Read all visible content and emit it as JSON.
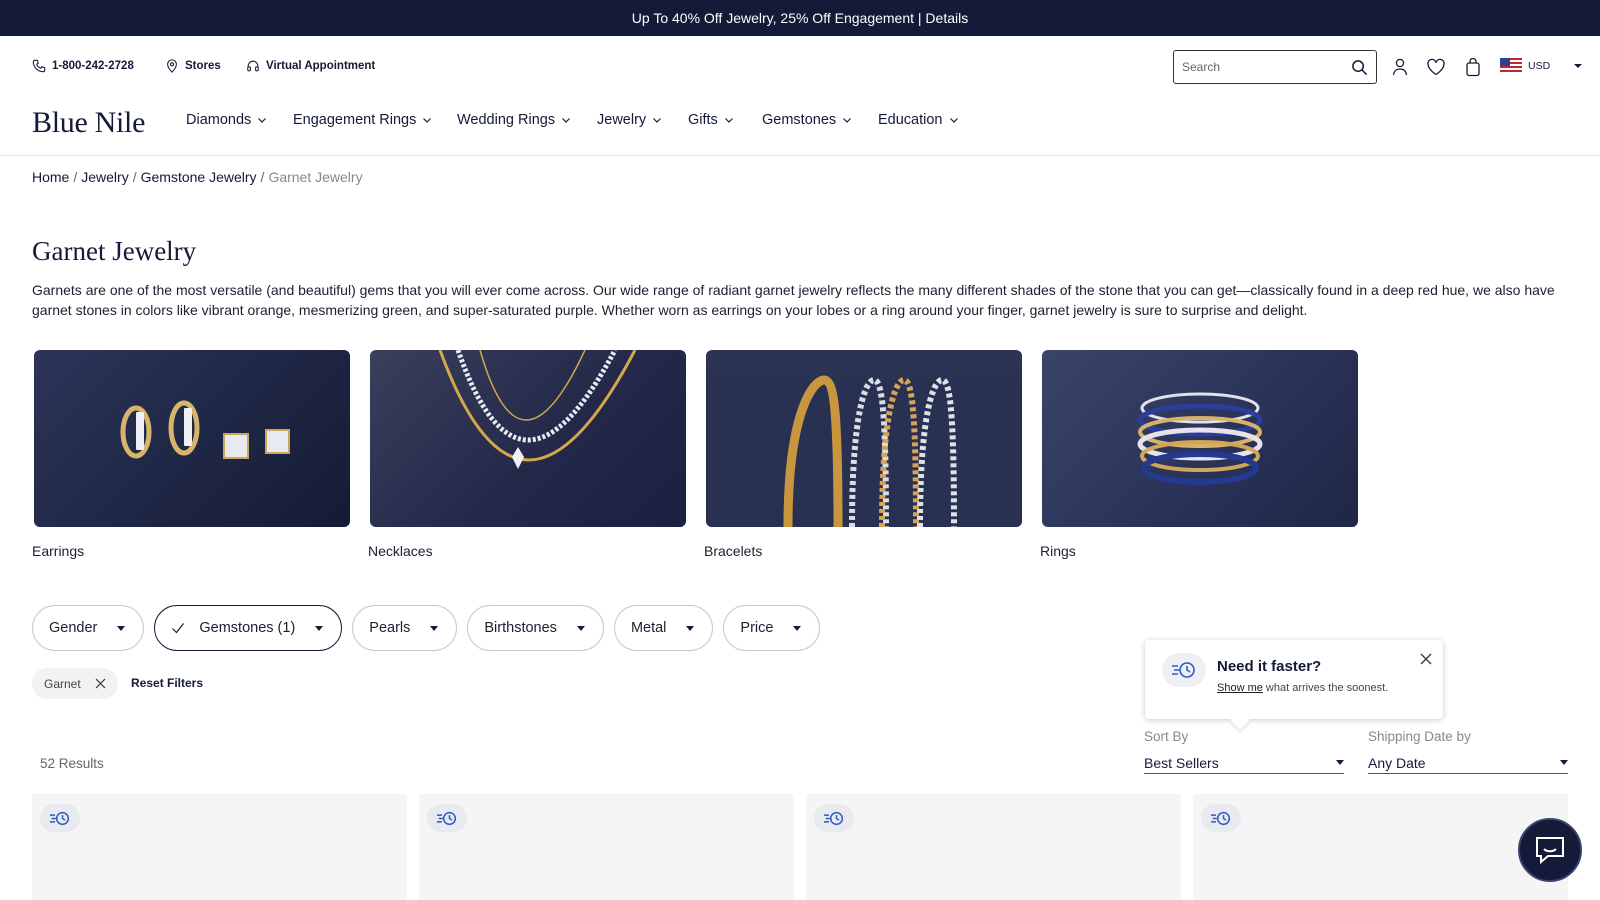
{
  "promo": {
    "text": "Up To 40% Off Jewelry, 25% Off Engagement | Details"
  },
  "utility": {
    "phone": "1-800-242-2728",
    "stores": "Stores",
    "appointment": "Virtual Appointment",
    "search_placeholder": "Search",
    "currency": "USD"
  },
  "brand": {
    "logo": "Blue Nile"
  },
  "nav": {
    "items": [
      "Diamonds",
      "Engagement Rings",
      "Wedding Rings",
      "Jewelry",
      "Gifts",
      "Gemstones",
      "Education"
    ]
  },
  "breadcrumb": {
    "items": [
      "Home",
      "Jewelry",
      "Gemstone Jewelry"
    ],
    "current": "Garnet Jewelry"
  },
  "page": {
    "title": "Garnet Jewelry",
    "description": "Garnets are one of the most versatile (and beautiful) gems that you will ever come across. Our wide range of radiant garnet jewelry reflects the many different shades of the stone that you can get—classically found in a deep red hue, we also have garnet stones in colors like vibrant orange, mesmerizing green, and super-saturated purple. Whether worn as earrings on your lobes or a ring around your finger, garnet jewelry is sure to surprise and delight."
  },
  "categories": [
    {
      "label": "Earrings"
    },
    {
      "label": "Necklaces"
    },
    {
      "label": "Bracelets"
    },
    {
      "label": "Rings"
    }
  ],
  "filters": [
    {
      "label": "Gender",
      "active": false
    },
    {
      "label": "Gemstones (1)",
      "active": true
    },
    {
      "label": "Pearls",
      "active": false
    },
    {
      "label": "Birthstones",
      "active": false
    },
    {
      "label": "Metal",
      "active": false
    },
    {
      "label": "Price",
      "active": false
    }
  ],
  "active_filter": {
    "label": "Garnet"
  },
  "reset_label": "Reset Filters",
  "results": {
    "count_text": "52 Results"
  },
  "tooltip": {
    "title": "Need it faster?",
    "link_text": "Show me",
    "body_rest": " what arrives the soonest."
  },
  "sort": {
    "label": "Sort By",
    "value": "Best Sellers",
    "shipping_label": "Shipping Date by",
    "shipping_value": "Any Date"
  },
  "colors": {
    "navy": "#141a38",
    "muted": "#888888",
    "card_bg": "#f5f5f6"
  },
  "icons": [
    "phone-icon",
    "location-pin-icon",
    "headset-icon",
    "search-icon",
    "user-icon",
    "heart-icon",
    "bag-icon",
    "chevron-down-icon",
    "check-icon",
    "close-icon",
    "fast-shipping-icon",
    "chat-icon"
  ]
}
